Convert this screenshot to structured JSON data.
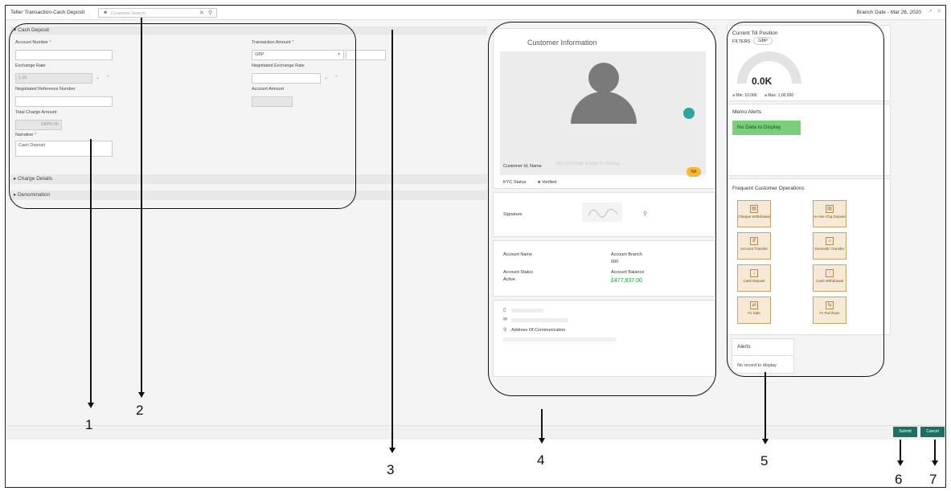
{
  "titlebar": {
    "title": "Teller Transaction-Cash Deposit",
    "search_placeholder": "Customer Search",
    "branch_date": "Branch Date - Mar 26, 2020"
  },
  "cash_deposit": {
    "section": "Cash Deposit",
    "account_number_label": "Account Number",
    "transaction_amount_label": "Transaction Amount",
    "currency": "GBP",
    "exchange_rate_label": "Exchange Rate",
    "exchange_rate_value": "1.00",
    "negotiated_exchange_rate_label": "Negotiated Exchange Rate",
    "negotiated_reference_label": "Negotiated Reference Number",
    "account_amount_label": "Account Amount",
    "total_charge_label": "Total Charge Amount",
    "total_charge_value": "GBP0.00",
    "narrative_label": "Narrative",
    "narrative_value": "Cash Deposit",
    "required_mark": "*"
  },
  "sections": {
    "charge_details": "Charge Details",
    "denomination": "Denomination"
  },
  "customer_info": {
    "title": "Customer Information",
    "no_image": "No customer image to display",
    "id_name_label": "Customer Id, Name",
    "na_badge": "NA",
    "kyc_label": "KYC Status",
    "kyc_value": "Verified",
    "signature_label": "Signature",
    "account_name_label": "Account Name",
    "account_branch_label": "Account Branch",
    "account_branch_value": "000",
    "account_status_label": "Account Status",
    "account_status_value": "Active",
    "account_balance_label": "Account Balance",
    "account_balance_value": "£477,837.00",
    "address_label": "Address Of Communication"
  },
  "till": {
    "title": "Current Till Position",
    "filters_label": "FILTERS",
    "filter_value": "GBP",
    "gauge_value": "0.0K",
    "gauge_fill": 0,
    "min_label": "Min: 10,000",
    "max_label": "Max: 1,00,000",
    "min_color": "#e0733a",
    "max_color": "#4caf50"
  },
  "memo": {
    "title": "Memo Alerts",
    "empty": "No Data to Display"
  },
  "frequent_ops": {
    "title": "Frequent Customer Operations",
    "items": [
      {
        "label": "Cheque Withdrawal",
        "icon": "cheque-icon"
      },
      {
        "label": "In-Hse Chq Deposit",
        "icon": "cheque-deposit-icon"
      },
      {
        "label": "Account Transfer",
        "icon": "transfer-icon"
      },
      {
        "label": "Domestic Transfer",
        "icon": "bank-icon"
      },
      {
        "label": "Cash Deposit",
        "icon": "cash-deposit-icon"
      },
      {
        "label": "Cash Withdrawal",
        "icon": "cash-withdrawal-icon"
      },
      {
        "label": "Fx Sale",
        "icon": "fx-sale-icon"
      },
      {
        "label": "Fx Purchase",
        "icon": "fx-purchase-icon"
      }
    ]
  },
  "alerts": {
    "title": "Alerts",
    "empty": "No record to display"
  },
  "buttons": {
    "submit": "Submit",
    "cancel": "Cancel"
  },
  "callouts": [
    "1",
    "2",
    "3",
    "4",
    "5",
    "6",
    "7"
  ],
  "colors": {
    "accent": "#1e6f63",
    "memo_green": "#7ccf7a",
    "balance_green": "#1a9b3c",
    "tile_bg": "#f6ead6"
  }
}
